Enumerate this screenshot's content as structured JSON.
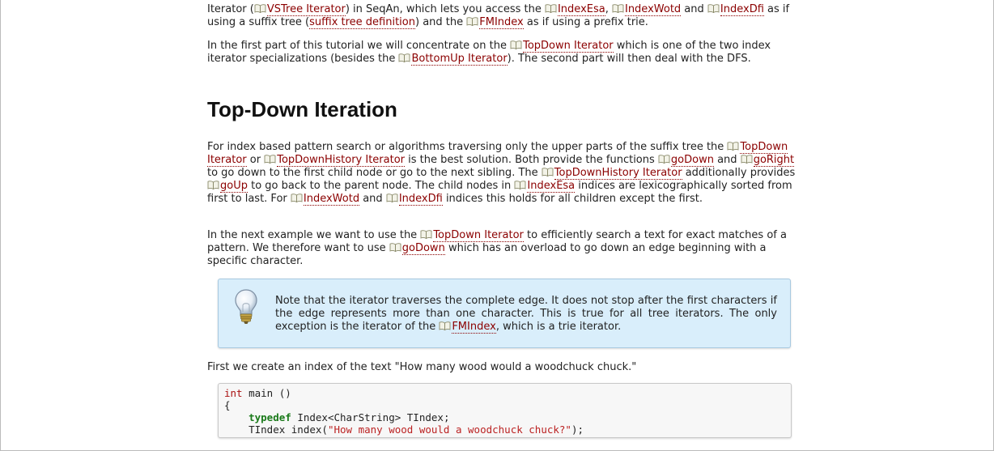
{
  "p1": {
    "t1": "Iterator (",
    "l1": "VSTree Iterator",
    "t2": ") in SeqAn, which lets you access the ",
    "l2": "IndexEsa",
    "t3": ", ",
    "l3": "IndexWotd",
    "t4": " and ",
    "l4": "IndexDfi",
    "t5": " as if using a suffix tree (",
    "l5": "suffix tree definition",
    "t6": ") and the ",
    "l6": "FMIndex",
    "t7": " as if using a prefix trie."
  },
  "p2": {
    "t1": "In the first part of this tutorial we will concentrate on the ",
    "l1": "TopDown Iterator",
    "t2": " which is one of the two index iterator specializations (besides the ",
    "l2": "BottomUp Iterator",
    "t3": "). The second part will then deal with the DFS."
  },
  "heading": "Top-Down Iteration",
  "p3": {
    "t1": "For index based pattern search or algorithms traversing only the upper parts of the suffix tree the ",
    "l1": "TopDown Iterator",
    "t2": " or ",
    "l2": "TopDownHistory Iterator",
    "t3": " is the best solution. Both provide the functions ",
    "l3": "goDown",
    "t4": " and ",
    "l4": "goRight",
    "t5": " to go down to the first child node or go to the next sibling. The ",
    "l5": "TopDownHistory Iterator",
    "t6": " additionally provides ",
    "l6": "goUp",
    "t7": " to go back to the parent node. The child nodes in ",
    "l7": "IndexEsa",
    "t8": " indices are lexicographically sorted from first to last. For ",
    "l8": "IndexWotd",
    "t9": " and ",
    "l9": "IndexDfi",
    "t10": " indices this holds for all children except the first."
  },
  "p4": {
    "t1": "In the next example we want to use the ",
    "l1": "TopDown Iterator",
    "t2": " to efficiently search a text for exact matches of a pattern. We therefore want to use ",
    "l2": "goDown",
    "t3": " which has an overload to go down an edge beginning with a specific character."
  },
  "note": {
    "t1": "Note that the iterator traverses the complete edge. It does not stop after the first characters if the edge represents more than one character. This is true for all tree iterators. The only exception is the iterator of the ",
    "l1": "FMIndex",
    "t2": ", which is a trie iterator.",
    "icon": "lightbulb-icon"
  },
  "p5": "First we create an index of the text \"How many wood would a woodchuck chuck.\"",
  "code": {
    "l1_kw": "int",
    "l1_rest": " main ()",
    "l2": "{",
    "l3_indent": "    ",
    "l3_kw": "typedef",
    "l3_rest": " Index<CharString> TIndex;",
    "l4_pre": "    TIndex index(",
    "l4_str": "\"How many wood would a woodchuck chuck?\"",
    "l4_post": ");"
  },
  "colors": {
    "link": "#8b0000",
    "note_bg": "#d9eefb",
    "code_bg": "#f7f7f7"
  }
}
